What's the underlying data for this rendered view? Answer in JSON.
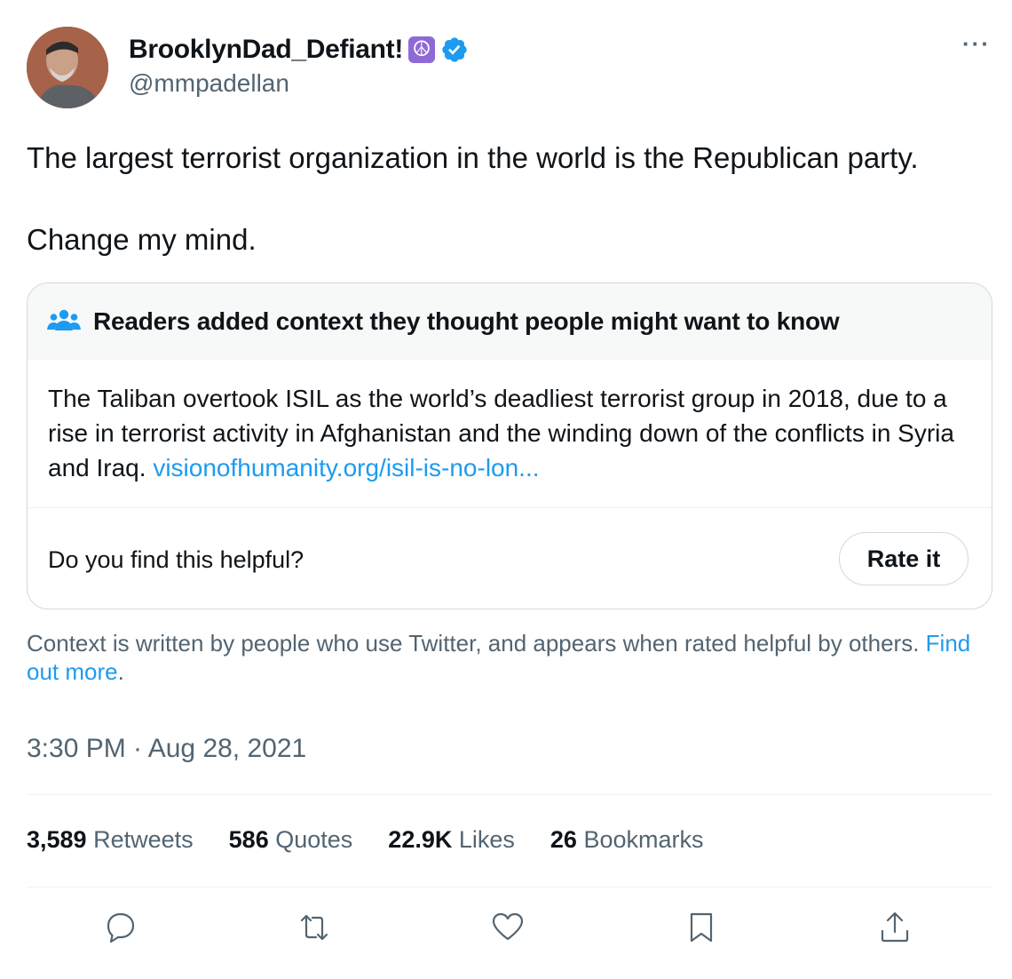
{
  "author": {
    "display_name": "BrooklynDad_Defiant!",
    "peace_emoji": "☮",
    "handle": "@mmpadellan"
  },
  "more_icon": "···",
  "tweet": {
    "line1": "The largest terrorist organization in the world is the Republican party.",
    "line2": "Change my mind."
  },
  "note": {
    "header": "Readers added context they thought people might want to know",
    "body": "The Taliban overtook ISIL as the world’s deadliest terrorist group in 2018, due to a rise in terrorist activity in Afghanistan and the winding down of the conflicts in Syria and Iraq. ",
    "link": "visionofhumanity.org/isil-is-no-lon...",
    "helpful_question": "Do you find this helpful?",
    "rate_label": "Rate it"
  },
  "context_footer": {
    "text": "Context is written by people who use Twitter, and appears when rated helpful by others. ",
    "link": "Find out more",
    "period": "."
  },
  "timestamp": "3:30 PM · Aug 28, 2021",
  "stats": [
    {
      "count": "3,589",
      "label": "Retweets"
    },
    {
      "count": "586",
      "label": "Quotes"
    },
    {
      "count": "22.9K",
      "label": "Likes"
    },
    {
      "count": "26",
      "label": "Bookmarks"
    }
  ],
  "colors": {
    "accent": "#1d9bf0",
    "secondary_text": "#536471",
    "border": "#cfd9de"
  },
  "icons": [
    "reply-icon",
    "retweet-icon",
    "like-icon",
    "bookmark-icon",
    "share-icon"
  ]
}
